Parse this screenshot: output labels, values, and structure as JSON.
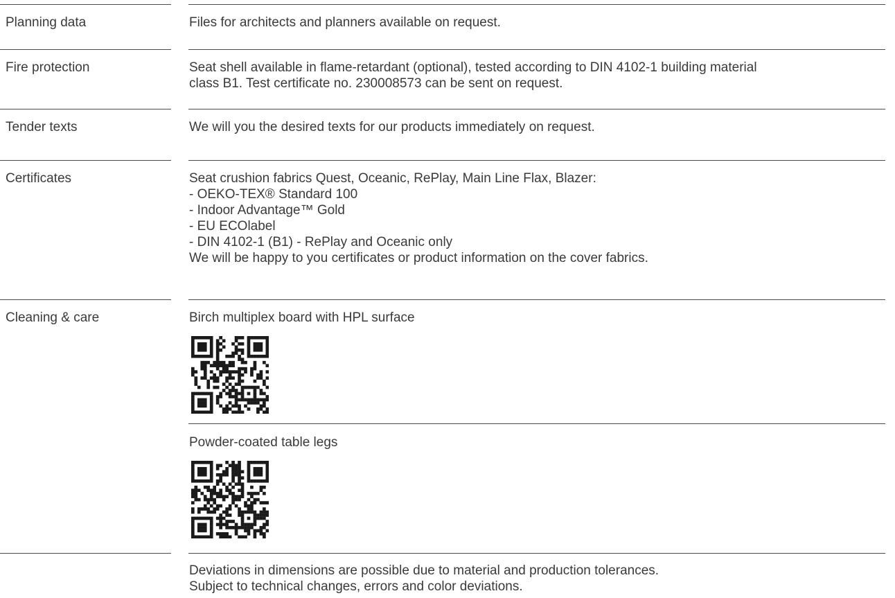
{
  "rows": [
    {
      "label": "Planning data",
      "lines": [
        "Files for architects and planners available on request."
      ]
    },
    {
      "label": "Fire protection",
      "lines": [
        "Seat shell available in flame-retardant (optional), tested according to DIN 4102-1 building material",
        "class B1. Test certificate no. 230008573 can be sent on request."
      ]
    },
    {
      "label": "Tender texts",
      "lines": [
        "We will you the desired texts for our products immediately on request."
      ]
    },
    {
      "label": "Certificates",
      "lines": [
        "Seat crushion fabrics Quest, Oceanic, RePlay, Main Line Flax, Blazer:",
        "- OEKO-TEX® Standard 100",
        "- Indoor Advantage™ Gold",
        "- EU ECOlabel",
        "- DIN 4102-1 (B1) - RePlay and Oceanic only",
        "We will be happy to you certificates or product information on the cover fabrics."
      ]
    },
    {
      "label": "Cleaning & care",
      "items": [
        {
          "title": "Birch multiplex board with HPL surface",
          "qr_icon": "qr-code-icon"
        },
        {
          "title": "Powder-coated table legs",
          "qr_icon": "qr-code-icon"
        }
      ]
    },
    {
      "label": "",
      "lines": [
        "Deviations in dimensions are possible due to material and production tolerances.",
        "Subject to technical changes, errors and color deviations."
      ]
    }
  ]
}
